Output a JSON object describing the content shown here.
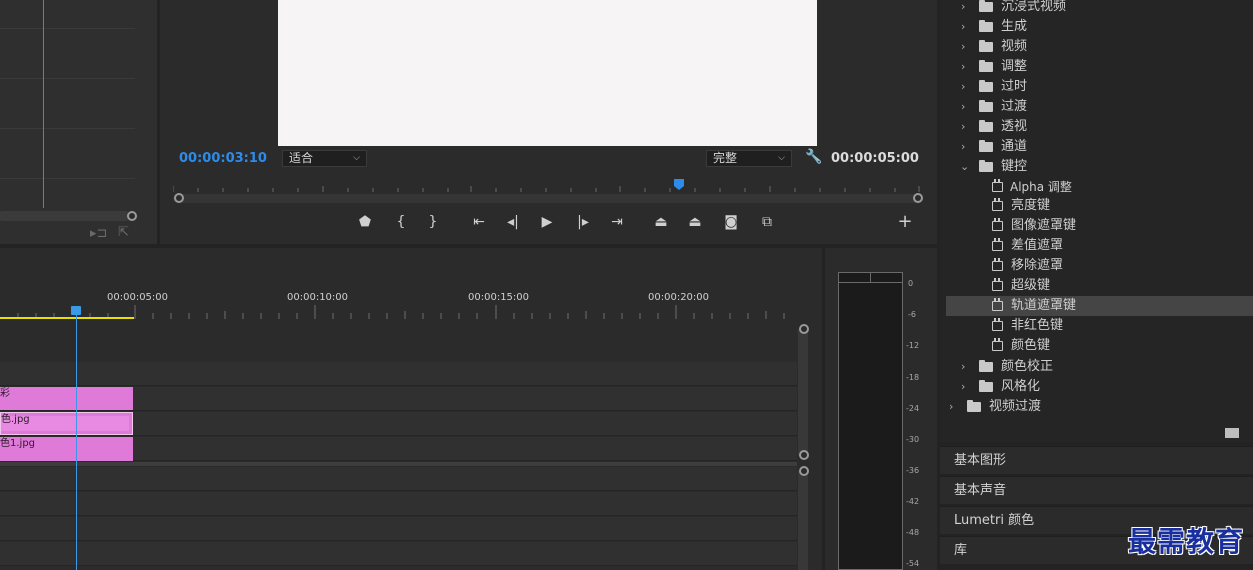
{
  "program_monitor": {
    "current_time": "00:00:03:10",
    "zoom_value": "适合",
    "quality_value": "完整",
    "duration": "00:00:05:00"
  },
  "timeline": {
    "ruler_labels": [
      "00:00:05:00",
      "00:00:10:00",
      "00:00:15:00",
      "00:00:20:00"
    ],
    "clips": [
      {
        "name": "彩"
      },
      {
        "name": "色.jpg"
      },
      {
        "name": "色1.jpg"
      }
    ]
  },
  "audio_meter": {
    "db_labels": [
      "0",
      "-6",
      "-12",
      "-18",
      "-24",
      "-30",
      "-36",
      "-42",
      "-48",
      "-54"
    ]
  },
  "effects": {
    "folders_top": [
      "沉浸式视频",
      "生成",
      "视频",
      "调整",
      "过时",
      "过渡",
      "透视",
      "通道"
    ],
    "keying_folder": "键控",
    "keying_items": [
      "Alpha 调整",
      "亮度键",
      "图像遮罩键",
      "差值遮罩",
      "移除遮罩",
      "超级键",
      "轨道遮罩键",
      "非红色键",
      "颜色键"
    ],
    "selected_item": "轨道遮罩键",
    "folders_bottom": [
      "颜色校正",
      "风格化"
    ],
    "video_transitions": "视频过渡"
  },
  "side_panels": [
    "基本图形",
    "基本声音",
    "Lumetri 颜色",
    "库"
  ],
  "watermark": "最需教育",
  "colors": {
    "accent_blue": "#2d8ceb",
    "clip_pink": "#e07ad9",
    "inout_yellow": "#e8e000"
  }
}
